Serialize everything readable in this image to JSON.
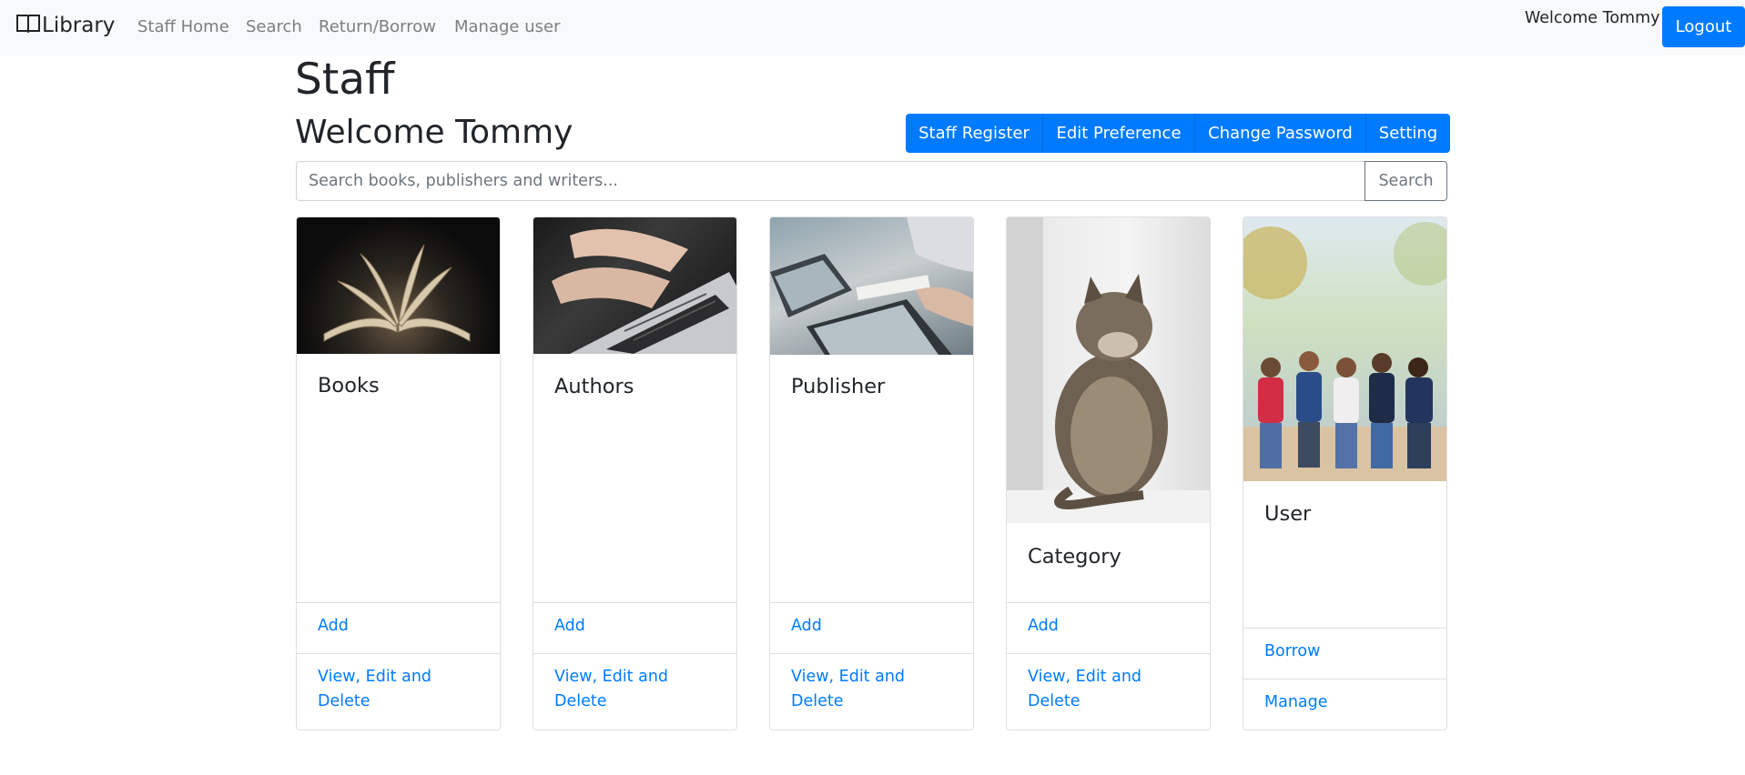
{
  "navbar": {
    "brand": "Library",
    "links": [
      "Staff Home",
      "Search",
      "Return/Borrow",
      "Manage user"
    ],
    "welcome": "Welcome Tommy",
    "logout_label": "Logout"
  },
  "page": {
    "title": "Staff",
    "welcome": "Welcome Tommy"
  },
  "actions": [
    "Staff Register",
    "Edit Preference",
    "Change Password",
    "Setting"
  ],
  "search": {
    "placeholder": "Search books, publishers and writers...",
    "button_label": "Search"
  },
  "cards": [
    {
      "title": "Books",
      "image": "open-book-photo",
      "links": [
        "Add",
        "View, Edit and Delete"
      ]
    },
    {
      "title": "Authors",
      "image": "laptop-typing-photo",
      "links": [
        "Add",
        "View, Edit and Delete"
      ]
    },
    {
      "title": "Publisher",
      "image": "office-desk-photo",
      "links": [
        "Add",
        "View, Edit and Delete"
      ]
    },
    {
      "title": "Category",
      "image": "cat-photo",
      "links": [
        "Add",
        "View, Edit and Delete"
      ]
    },
    {
      "title": "User",
      "image": "group-of-people-photo",
      "links": [
        "Borrow",
        "Manage"
      ]
    }
  ],
  "colors": {
    "primary": "#007bff",
    "navbar_bg": "#f8f9fa",
    "muted_link": "#7a7f84",
    "border": "#dfdfdf"
  }
}
